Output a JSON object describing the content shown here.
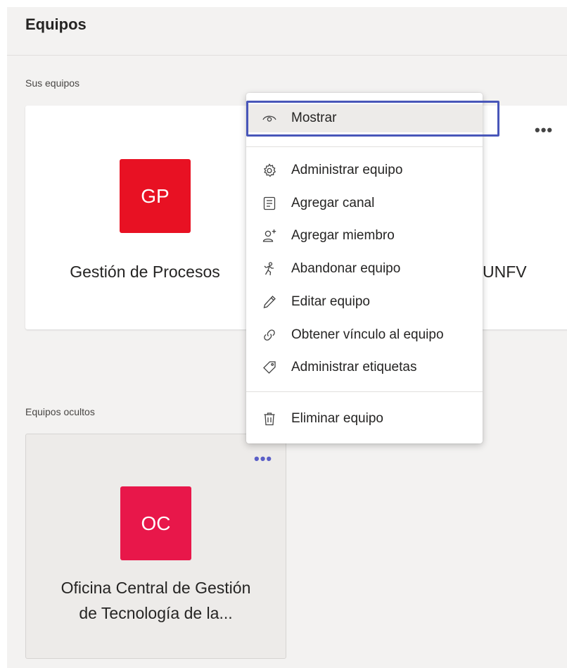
{
  "header": {
    "title": "Equipos"
  },
  "sections": {
    "your_teams_label": "Sus equipos",
    "hidden_teams_label": "Equipos ocultos"
  },
  "teams": [
    {
      "initials": "GP",
      "name": "Gestión de Procesos",
      "color": "#e81123"
    },
    {
      "name_partial": "UNFV"
    }
  ],
  "hidden_teams": [
    {
      "initials": "OC",
      "name_line1": "Oficina Central de Gestión",
      "name_line2": "de Tecnología de la...",
      "color": "#e8174a"
    }
  ],
  "more_options": "•••",
  "context_menu": {
    "items": [
      {
        "label": "Mostrar",
        "icon": "eye-icon"
      },
      {
        "label": "Administrar equipo",
        "icon": "gear-icon"
      },
      {
        "label": "Agregar canal",
        "icon": "channel-icon"
      },
      {
        "label": "Agregar miembro",
        "icon": "add-person-icon"
      },
      {
        "label": "Abandonar equipo",
        "icon": "leave-icon"
      },
      {
        "label": "Editar equipo",
        "icon": "pencil-icon"
      },
      {
        "label": "Obtener vínculo al equipo",
        "icon": "link-icon"
      },
      {
        "label": "Administrar etiquetas",
        "icon": "tag-icon"
      },
      {
        "label": "Eliminar equipo",
        "icon": "trash-icon"
      }
    ]
  },
  "colors": {
    "accent": "#4856b9",
    "purple": "#5b5fc7"
  }
}
